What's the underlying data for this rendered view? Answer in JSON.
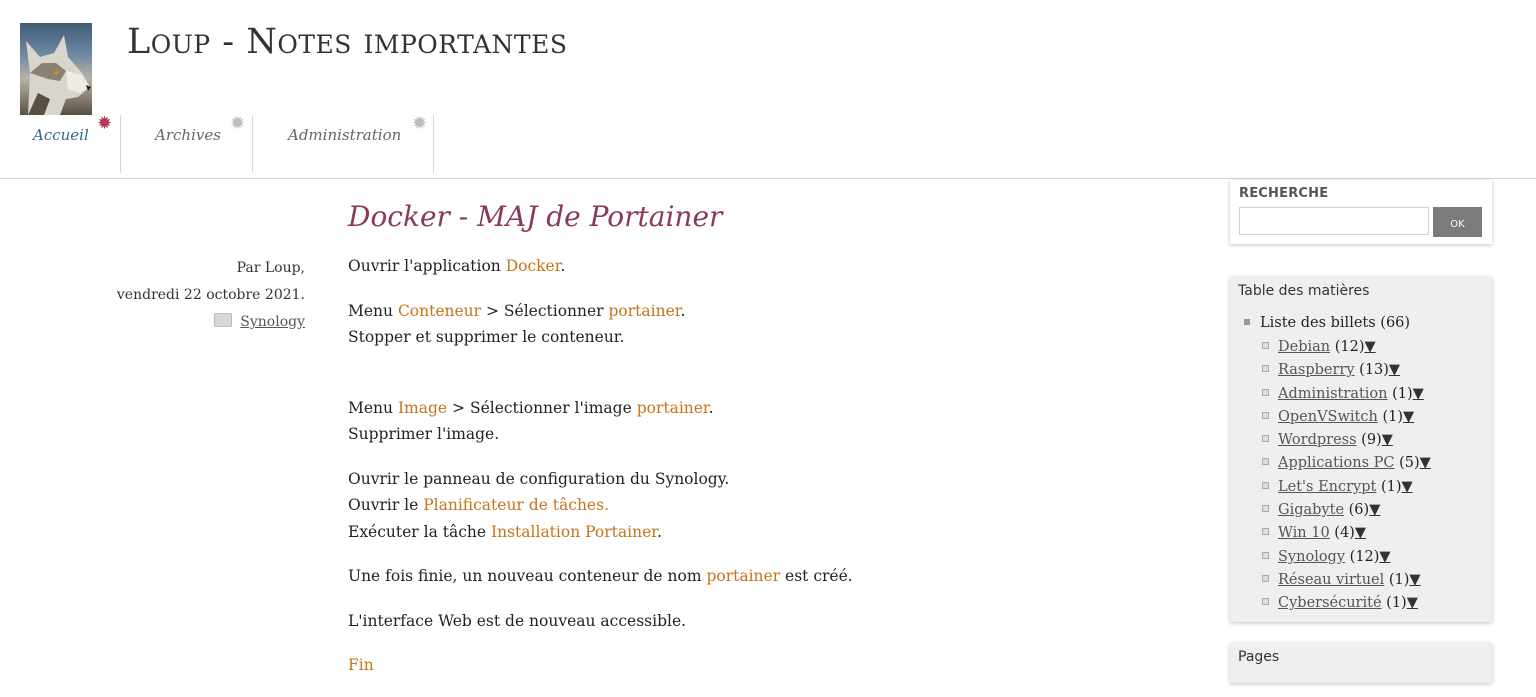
{
  "site": {
    "title": "Loup - Notes importantes"
  },
  "nav": [
    {
      "label": "Accueil",
      "active": true
    },
    {
      "label": "Archives",
      "active": false
    },
    {
      "label": "Administration",
      "active": false
    }
  ],
  "post": {
    "title": "Docker - MAJ de Portainer",
    "author": "Par Loup,",
    "date": "vendredi 22 octobre 2021.",
    "category": "Synology",
    "p1": {
      "a": "Ouvrir l'application ",
      "b": "Docker",
      "c": "."
    },
    "p2": {
      "a": "Menu ",
      "b": "Conteneur",
      "c": " > Sélectionner ",
      "d": "portainer",
      "e": ".",
      "line2": "Stopper et supprimer le conteneur."
    },
    "p3": {
      "a": "Menu ",
      "b": "Image",
      "c": " > Sélectionner l'image ",
      "d": "portainer",
      "e": ".",
      "line2": "Supprimer l'image."
    },
    "p4": {
      "line1": "Ouvrir le panneau de configuration du Synology.",
      "a": "Ouvrir le ",
      "b": "Planificateur de tâches.",
      "c": "Exécuter la tâche ",
      "d": "Installation Portainer",
      "e": "."
    },
    "p5": {
      "a": "Une fois finie, un nouveau conteneur de nom ",
      "b": "portainer",
      "c": " est créé."
    },
    "p6": "L'interface Web est de nouveau accessible.",
    "p7": "Fin"
  },
  "sidebar": {
    "search": {
      "heading": "Recherche",
      "button": "OK",
      "value": ""
    },
    "toc": {
      "heading": "Table des matières",
      "root": "Liste des billets (66)",
      "items": [
        {
          "label": "Debian",
          "count": "(12)"
        },
        {
          "label": "Raspberry",
          "count": "(13)"
        },
        {
          "label": "Administration",
          "count": "(1)"
        },
        {
          "label": "OpenVSwitch",
          "count": "(1)"
        },
        {
          "label": "Wordpress",
          "count": "(9)"
        },
        {
          "label": "Applications PC",
          "count": "(5)"
        },
        {
          "label": "Let's Encrypt",
          "count": "(1)"
        },
        {
          "label": "Gigabyte",
          "count": "(6)"
        },
        {
          "label": "Win 10",
          "count": "(4)"
        },
        {
          "label": "Synology",
          "count": "(12)"
        },
        {
          "label": "Réseau virtuel",
          "count": "(1)"
        },
        {
          "label": "Cybersécurité",
          "count": "(1)"
        }
      ],
      "toggle_glyph": "▼"
    },
    "pages": {
      "heading": "Pages"
    }
  }
}
